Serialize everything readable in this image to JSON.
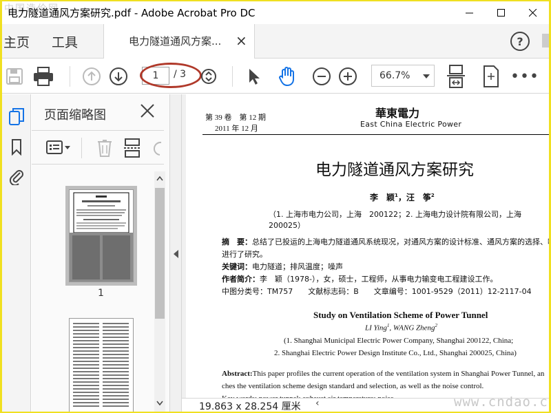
{
  "window": {
    "title": "电力隧道通风方案研究.pdf - Adobe Acrobat Pro DC",
    "watermark_top": "中国造价网"
  },
  "nav": {
    "home": "主页",
    "tools": "工具",
    "doc_tab": "电力隧道通风方案...",
    "help": "?"
  },
  "toolbar": {
    "current_page": "1",
    "total_pages": "/ 3",
    "zoom": "66.7%"
  },
  "panel": {
    "title": "页面缩略图",
    "thumb_label_1": "1"
  },
  "document": {
    "journal_volume": "第 39 卷　第 12 期",
    "journal_date": "2011 年 12 月",
    "journal_name": "華東電力",
    "journal_name_en": "East China Electric Power",
    "title_cn": "电力隧道通风方案研究",
    "authors_cn": "李　颖",
    "authors_cn_2": "，汪　筝",
    "affiliation_cn": "（1. 上海市电力公司，上海　200122；2. 上海电力设计院有限公司，上海　200025）",
    "abstract_label": "摘　要：",
    "abstract_cn_1": "总结了已投运的上海电力隧道通风系统现况，对通风方案的设计标准、通风方案的选择、噪声",
    "abstract_cn_2": "进行了研究。",
    "keywords_label": "关键词：",
    "keywords_cn": "电力隧道；排风温度；噪声",
    "author_info_label": "作者简介：",
    "author_info": "李　颖（1978-），女，硕士，工程师，从事电力输变电工程建设工作。",
    "class_line": "中图分类号：TM757　　文献标志码：B　　文章编号：1001-9529（2011）12-2117-04",
    "title_en": "Study on Ventilation Scheme of Power Tunnel",
    "authors_en_1": "LI Ying",
    "authors_en_2": ", WANG Zheng",
    "affil_en_1": "(1. Shanghai Municipal Electric Power Company, Shanghai 200122, China;",
    "affil_en_2": "2. Shanghai Electric Power Design Institute Co., Ltd., Shanghai 200025, China)",
    "abstract_en_label": "Abstract:",
    "abstract_en_1": "This paper profiles the current operation of the ventilation system in Shanghai Power Tunnel, an",
    "abstract_en_2": "ches the ventilation scheme design standard and selection, as well as the noise control.",
    "keywords_en_partial": "Key words: power tunnel; exhaust air temperature; noise"
  },
  "status": {
    "page_size": "19.863 x 28.254 厘米",
    "watermark": "www.cndao.com"
  },
  "colors": {
    "accent_blue": "#1473e6",
    "oval_red": "#b0392a"
  }
}
